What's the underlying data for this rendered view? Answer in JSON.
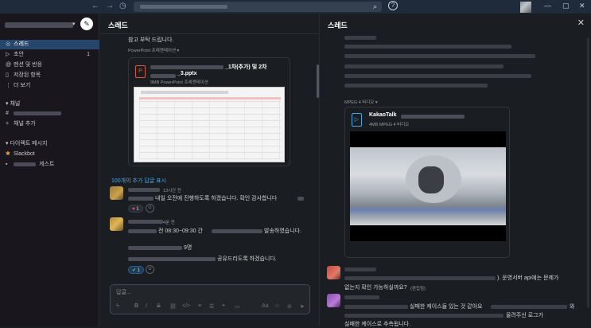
{
  "sidebar": {
    "items": [
      {
        "label": "스레드",
        "icon": "threads-icon",
        "active": true
      },
      {
        "label": "초안",
        "icon": "drafts-icon",
        "count": "1"
      },
      {
        "label": "멘션 및 반응",
        "icon": "mentions-icon"
      },
      {
        "label": "저장된 항목",
        "icon": "bookmark-icon"
      },
      {
        "label": "더 보기",
        "icon": "more-icon"
      }
    ],
    "channels_header": "채널",
    "add_channel": "채널 추가",
    "dm_header": "다이렉트 메시지",
    "dm_items": [
      {
        "label": "Slackbot"
      },
      {
        "label": "게스트"
      }
    ]
  },
  "main": {
    "title": "스레드",
    "intro_text": "참고 부탁 드립니다.",
    "file_type_label": "PowerPoint 프레젠테이션",
    "file": {
      "name_part1": "_1차(추가) 및 2차",
      "name_part2": "_3.pptx",
      "meta": "9MB PowerPoint 프레젠테이션"
    },
    "replies_link": "100개의 추가 답글 표시",
    "messages": [
      {
        "time": "13시간 전",
        "text": "내일 오전에 진행하도록 하겠습니다. 확인 감사합니다",
        "reaction_count": "1"
      },
      {
        "time": "4분 전",
        "line1a": "전 08:30~09:30 간",
        "line1b": "발송하였습니다.",
        "line2": "9명",
        "line3": "공유드리도록 하겠습니다.",
        "reaction_count": "1"
      }
    ],
    "composer_placeholder": "답글..."
  },
  "thread": {
    "title": "스레드",
    "file_type_label": "MPEG 4 비디오",
    "file": {
      "name": "KakaoTalk",
      "meta": "4MB MPEG 4 비디오"
    },
    "msg1_text": "). 운영서버 api에는 문제가",
    "msg1_text2": "없는지 확인 가능하실까요?",
    "msg1_edited": "(편집됨)",
    "msg2_text": "실패한 케이스들 있는 것 같아요",
    "msg2_text2": "와",
    "msg2_text3": "올려주신 로그가",
    "msg2_text4": "실패한 케이스로 추측됩니다."
  }
}
